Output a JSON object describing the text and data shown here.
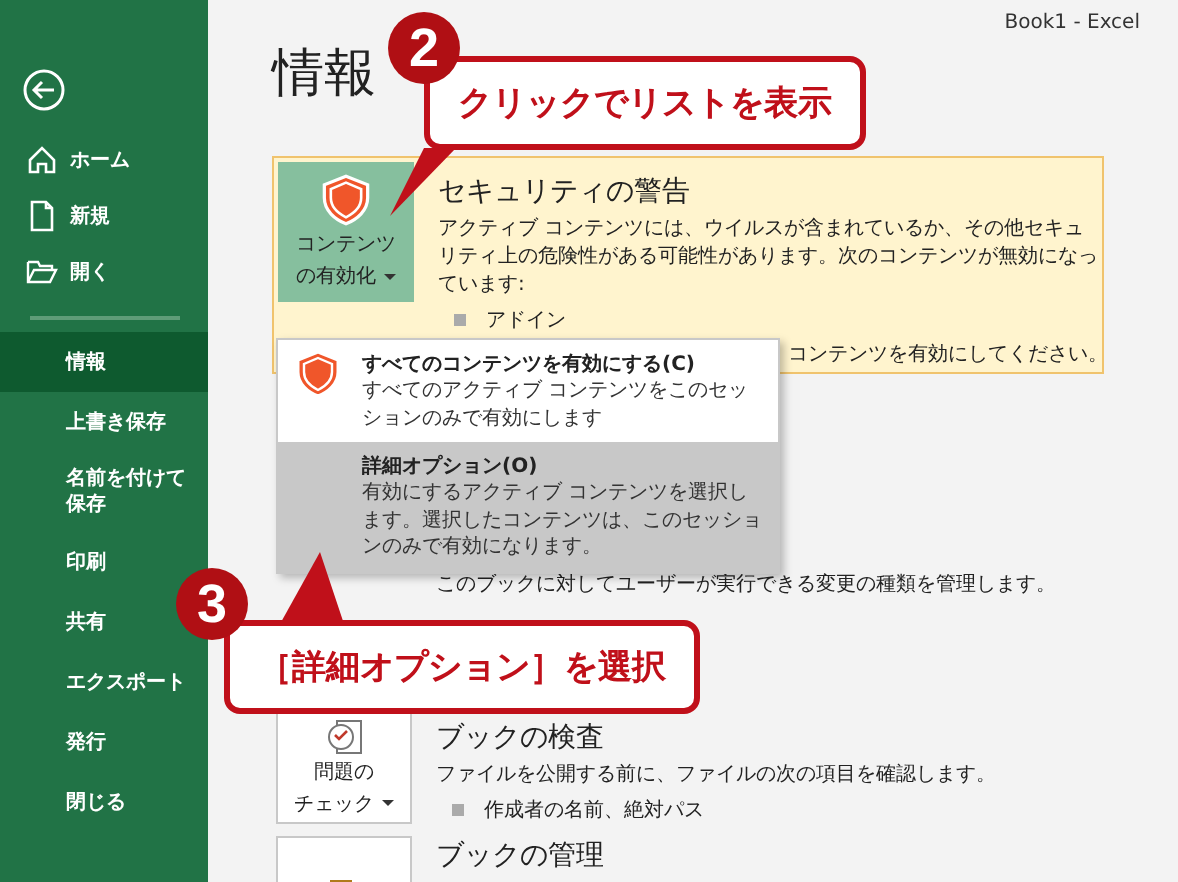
{
  "window": {
    "title": "Book1 - Excel"
  },
  "sidebar": {
    "top_items": [
      {
        "kind": "home",
        "label": "ホーム"
      },
      {
        "kind": "new",
        "label": "新規"
      },
      {
        "kind": "open",
        "label": "開く"
      }
    ],
    "nav": [
      {
        "label": "情報",
        "selected": true
      },
      {
        "label": "上書き保存",
        "selected": false
      },
      {
        "label": "名前を付けて保存",
        "selected": false
      },
      {
        "label": "印刷",
        "selected": false
      },
      {
        "label": "共有",
        "selected": false
      },
      {
        "label": "エクスポート",
        "selected": false
      },
      {
        "label": "発行",
        "selected": false
      },
      {
        "label": "閉じる",
        "selected": false
      }
    ]
  },
  "heading": "情報",
  "security": {
    "button_lines": [
      "コンテンツ",
      "の有効化"
    ],
    "title": "セキュリティの警告",
    "description": "アクティブ コンテンツには、ウイルスが含まれているか、その他セキュリティ上の危険性がある可能性があります。次のコンテンツが無効になっています:",
    "bullets": [
      "アドイン"
    ],
    "note": "コンテンツを有効にしてください。"
  },
  "menu": {
    "items": [
      {
        "kind": "shield",
        "title": "すべてのコンテンツを有効にする(C)",
        "description": "すべてのアクティブ コンテンツをこのセッションのみで有効にします",
        "selected": false
      },
      {
        "kind": "plain",
        "title": "詳細オプション(O)",
        "description": "有効にするアクティブ コンテンツを選択します。選択したコンテンツは、このセッションのみで有効になります。",
        "selected": true
      }
    ]
  },
  "protection": {
    "description": "このブックに対してユーザーが実行できる変更の種類を管理します。"
  },
  "inspect": {
    "button_lines": [
      "問題の",
      "チェック"
    ],
    "title": "ブックの検査",
    "description": "ファイルを公開する前に、ファイルの次の項目を確認します。",
    "bullets": [
      "作成者の名前、絶対パス"
    ]
  },
  "manage": {
    "title": "ブックの管理"
  },
  "callouts": [
    {
      "number": "2",
      "text": "クリックでリストを表示"
    },
    {
      "number": "3",
      "text": "［詳細オプション］を選択"
    }
  ]
}
